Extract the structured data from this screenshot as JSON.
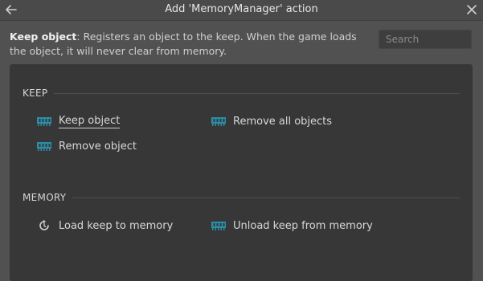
{
  "window": {
    "title": "Add 'MemoryManager' action",
    "back_icon": "back-arrow-icon",
    "close_icon": "close-icon"
  },
  "description": {
    "name": "Keep object",
    "text": ": Registers an object to the keep. When the game loads the object, it will never clear from memory."
  },
  "search": {
    "placeholder": "Search",
    "value": ""
  },
  "colors": {
    "background": "#515151",
    "panel": "#373737",
    "memory_icon": "#2b8fa8"
  },
  "sections": [
    {
      "header": "KEEP",
      "actions": [
        {
          "label": "Keep object",
          "icon": "memory-chip-icon",
          "selected": true
        },
        {
          "label": "Remove all objects",
          "icon": "memory-chip-icon",
          "selected": false
        },
        {
          "label": "Remove object",
          "icon": "memory-chip-icon",
          "selected": false
        }
      ]
    },
    {
      "header": "MEMORY",
      "actions": [
        {
          "label": "Load keep to memory",
          "icon": "reload-icon",
          "selected": false
        },
        {
          "label": "Unload keep from memory",
          "icon": "memory-chip-icon",
          "selected": false
        }
      ]
    }
  ]
}
